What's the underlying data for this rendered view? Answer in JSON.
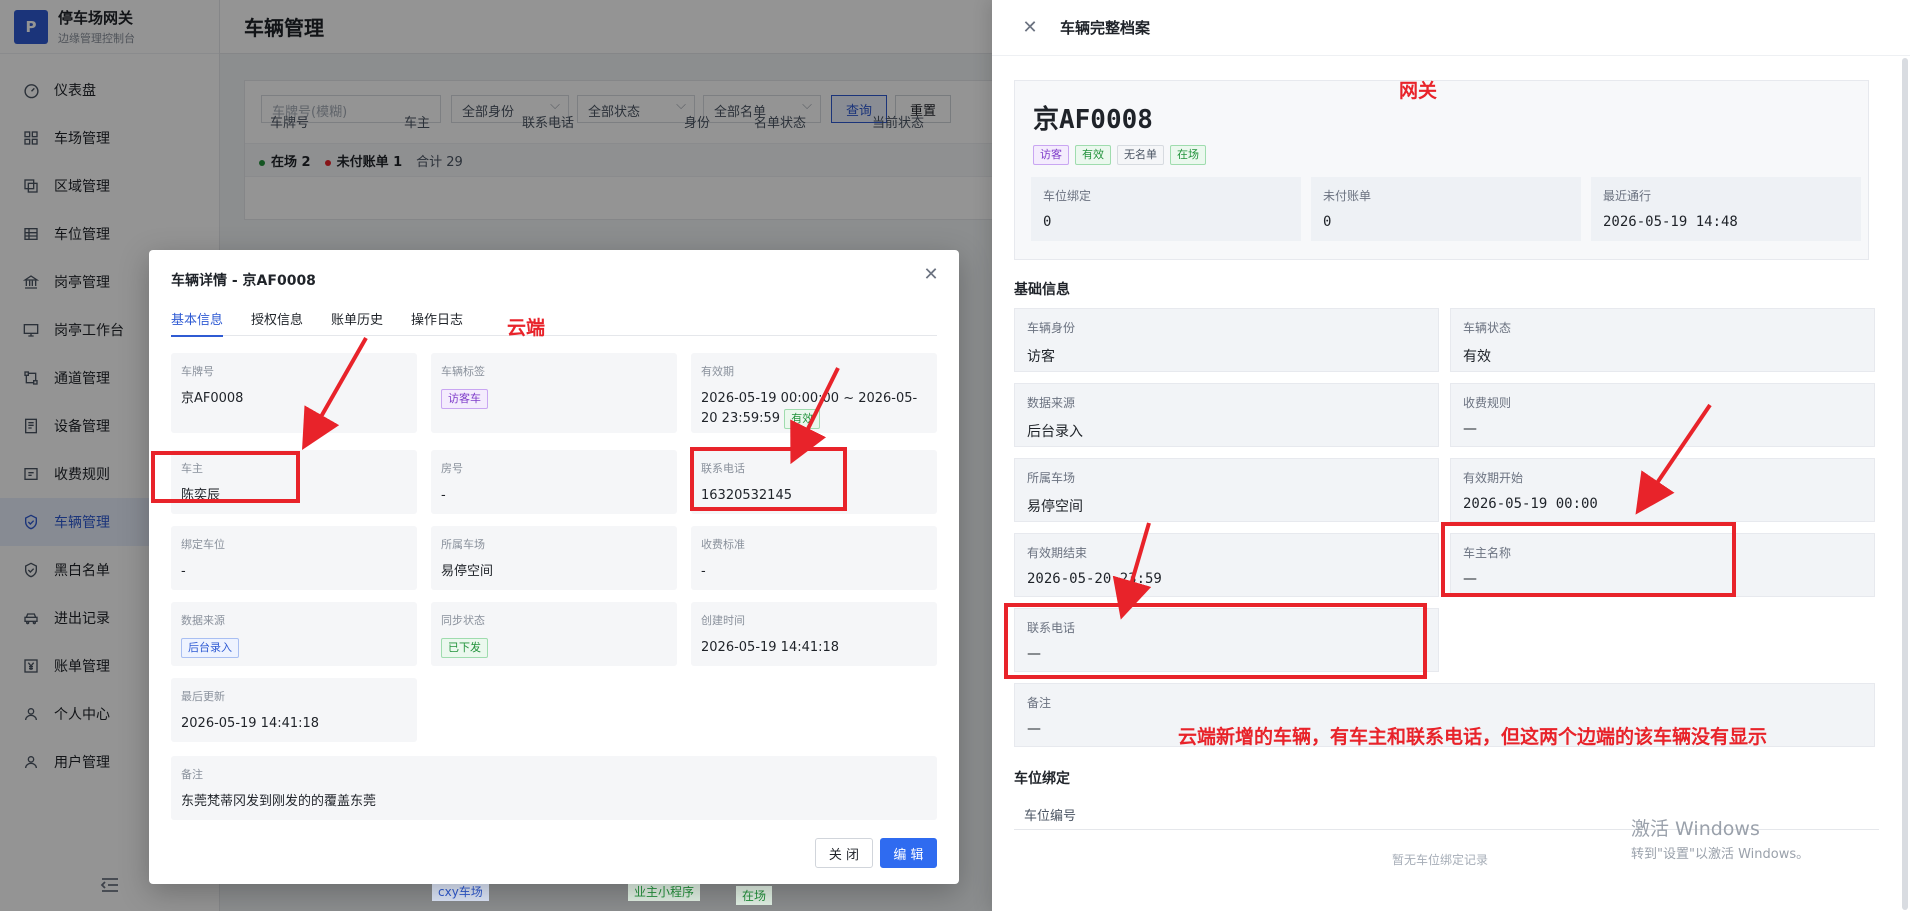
{
  "brand": {
    "logo": "P",
    "title": "停车场网关",
    "subtitle": "边缘管理控制台"
  },
  "sidebar": {
    "items": [
      {
        "label": "仪表盘",
        "icon": "dashboard-icon"
      },
      {
        "label": "车场管理",
        "icon": "grid-icon"
      },
      {
        "label": "区域管理",
        "icon": "copy-icon"
      },
      {
        "label": "车位管理",
        "icon": "table-icon"
      },
      {
        "label": "岗亭管理",
        "icon": "bank-icon"
      },
      {
        "label": "岗亭工作台",
        "icon": "monitor-icon"
      },
      {
        "label": "通道管理",
        "icon": "route-icon"
      },
      {
        "label": "设备管理",
        "icon": "device-icon"
      },
      {
        "label": "收费规则",
        "icon": "fee-icon"
      },
      {
        "label": "车辆管理",
        "icon": "shield-icon",
        "active": true
      },
      {
        "label": "黑白名单",
        "icon": "shield-check-icon"
      },
      {
        "label": "进出记录",
        "icon": "car-icon"
      },
      {
        "label": "账单管理",
        "icon": "yen-icon"
      },
      {
        "label": "个人中心",
        "icon": "user-icon"
      },
      {
        "label": "用户管理",
        "icon": "users-icon"
      }
    ]
  },
  "main": {
    "title": "车辆管理",
    "filters": {
      "plate_placeholder": "车牌号(模糊)",
      "identity": "全部身份",
      "status": "全部状态",
      "list": "全部名单",
      "query": "查询",
      "reset": "重置"
    },
    "stats": {
      "in_lot": "在场 2",
      "unpaid": "未付账单 1",
      "total": "合计 29"
    },
    "columns": [
      "车牌号",
      "车主",
      "联系电话",
      "身份",
      "名单状态",
      "当前状态"
    ],
    "behind_tags": [
      "cxy车场",
      "业主小程序",
      "在场"
    ]
  },
  "modal": {
    "title": "车辆详情 - 京AF0008",
    "tabs": [
      "基本信息",
      "授权信息",
      "账单历史",
      "操作日志"
    ],
    "fields": {
      "plate": {
        "label": "车牌号",
        "value": "京AF0008"
      },
      "tag": {
        "label": "车辆标签",
        "value": "访客车"
      },
      "validity": {
        "label": "有效期",
        "value": "2026-05-19 00:00:00 ~ 2026-05-20 23:59:59",
        "badge": "有效"
      },
      "owner": {
        "label": "车主",
        "value": "陈奕辰"
      },
      "room": {
        "label": "房号",
        "value": "-"
      },
      "phone": {
        "label": "联系电话",
        "value": "16320532145"
      },
      "bound_space": {
        "label": "绑定车位",
        "value": "-"
      },
      "lot": {
        "label": "所属车场",
        "value": "易停空间"
      },
      "fee_std": {
        "label": "收费标准",
        "value": "-"
      },
      "source": {
        "label": "数据来源",
        "value": "后台录入"
      },
      "sync": {
        "label": "同步状态",
        "value": "已下发"
      },
      "created": {
        "label": "创建时间",
        "value": "2026-05-19 14:41:18"
      },
      "updated": {
        "label": "最后更新",
        "value": "2026-05-19 14:41:18"
      },
      "remark": {
        "label": "备注",
        "value": "东莞梵蒂冈发到刚发的的覆盖东莞"
      }
    },
    "close": "关 闭",
    "edit": "编 辑"
  },
  "drawer": {
    "title": "车辆完整档案",
    "plate": "京AF0008",
    "tags": [
      "访客",
      "有效",
      "无名单",
      "在场"
    ],
    "stats": [
      {
        "label": "车位绑定",
        "value": "0"
      },
      {
        "label": "未付账单",
        "value": "0"
      },
      {
        "label": "最近通行",
        "value": "2026-05-19 14:48"
      }
    ],
    "basic_title": "基础信息",
    "basic": [
      {
        "label": "车辆身份",
        "value": "访客"
      },
      {
        "label": "车辆状态",
        "value": "有效"
      },
      {
        "label": "数据来源",
        "value": "后台录入"
      },
      {
        "label": "收费规则",
        "value": "—"
      },
      {
        "label": "所属车场",
        "value": "易停空间"
      },
      {
        "label": "有效期开始",
        "value": "2026-05-19 00:00"
      },
      {
        "label": "有效期结束",
        "value": "2026-05-20 23:59"
      },
      {
        "label": "车主名称",
        "value": "—"
      },
      {
        "label": "联系电话",
        "value": "—"
      },
      {
        "label": "备注",
        "value": "—"
      }
    ],
    "binding_title": "车位绑定",
    "binding_col": "车位编号",
    "binding_empty": "暂无车位绑定记录"
  },
  "annotations": {
    "cloud": "云端",
    "gateway": "网关",
    "note": "云端新增的车辆，有车主和联系电话，但这两个边端的该车辆没有显示"
  },
  "watermark": {
    "line1": "激活 Windows",
    "line2": "转到\"设置\"以激活 Windows。"
  },
  "colors": {
    "accent": "#2f5bd3",
    "annotation": "#e8232a",
    "primary_button": "#2f6bf0"
  }
}
